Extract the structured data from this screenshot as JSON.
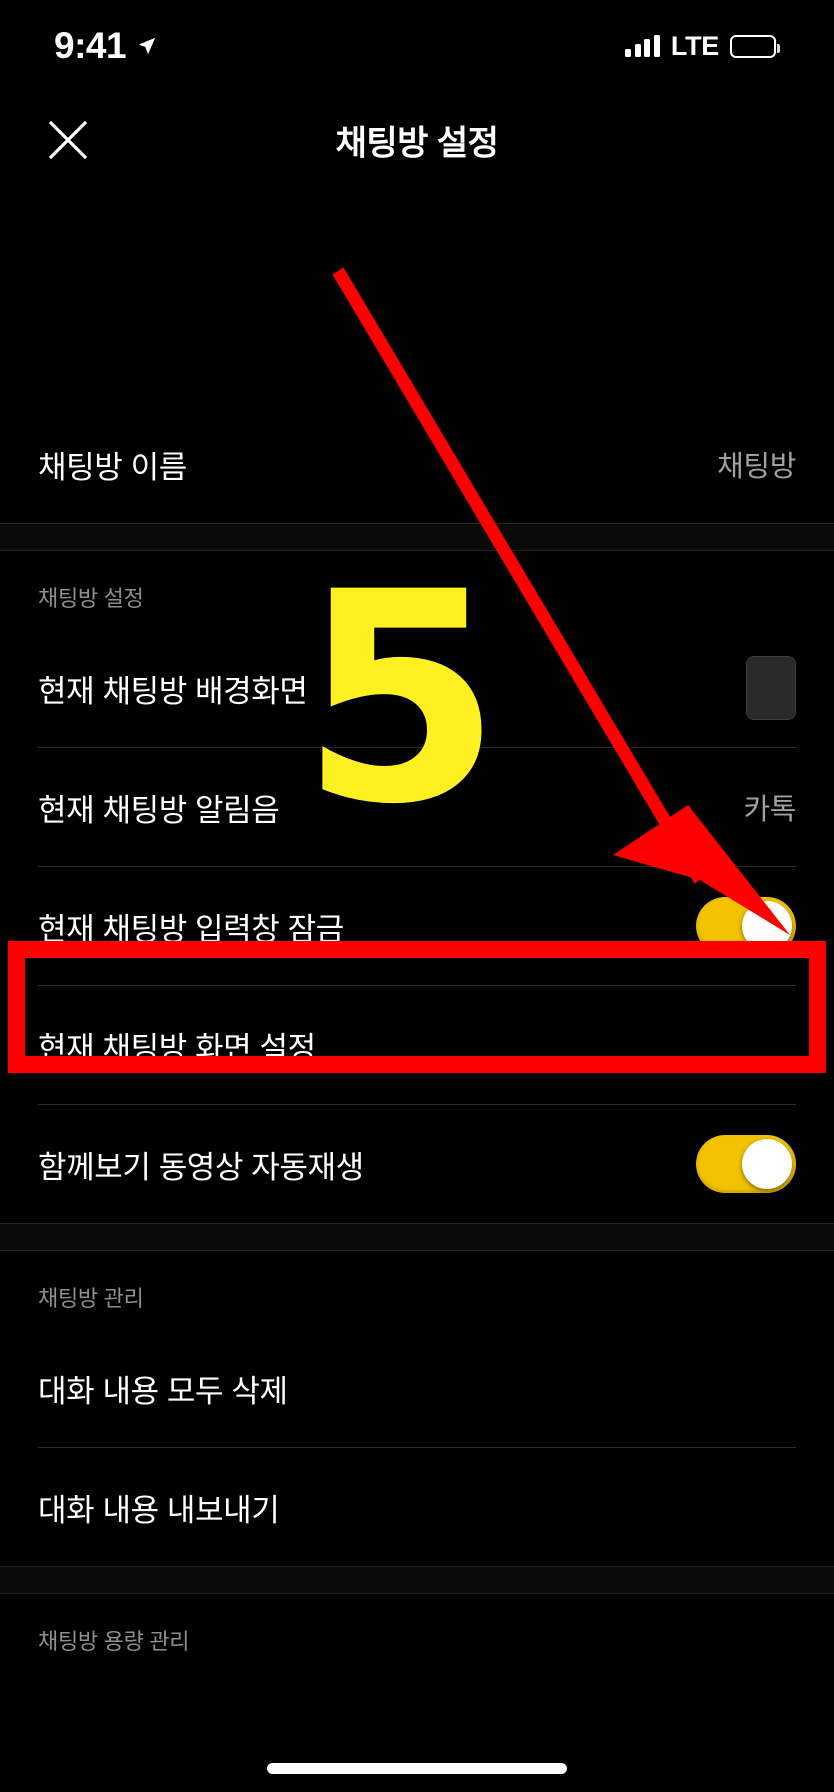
{
  "status_bar": {
    "time": "9:41",
    "carrier": "LTE",
    "location_icon": "location-arrow-icon",
    "signal_icon": "cellular-signal-icon",
    "battery_icon": "battery-full-icon"
  },
  "header": {
    "title": "채팅방 설정",
    "close_icon": "close-x-icon"
  },
  "sections": [
    {
      "header": "",
      "rows": [
        {
          "label": "채팅방 이름",
          "value": "채팅방",
          "type": "value"
        }
      ]
    },
    {
      "header": "채팅방 설정",
      "rows": [
        {
          "label": "현재 채팅방 배경화면",
          "value": "",
          "type": "thumbnail"
        },
        {
          "label": "현재 채팅방 알림음",
          "value": "카톡",
          "type": "value"
        },
        {
          "label": "현재 채팅방 입력창 잠금",
          "value": "on",
          "type": "toggle",
          "highlighted": true
        },
        {
          "label": "현재 채팅방 화면 설정",
          "value": "",
          "type": "plain"
        },
        {
          "label": "함께보기 동영상 자동재생",
          "value": "on",
          "type": "toggle"
        }
      ]
    },
    {
      "header": "채팅방 관리",
      "rows": [
        {
          "label": "대화 내용 모두 삭제",
          "value": "",
          "type": "plain"
        },
        {
          "label": "대화 내용 내보내기",
          "value": "",
          "type": "plain"
        }
      ]
    },
    {
      "header": "채팅방 용량 관리",
      "rows": []
    }
  ],
  "annotations": {
    "step_number": "5",
    "step_number_color": "#FFF021",
    "highlight_color": "#FF0000",
    "arrow_color": "#FF0000"
  },
  "theme": {
    "background": "#000000",
    "text_primary": "#FFFFFF",
    "text_secondary": "#A0A0A0",
    "toggle_on": "#F2C200",
    "divider": "#2B2B2B"
  }
}
